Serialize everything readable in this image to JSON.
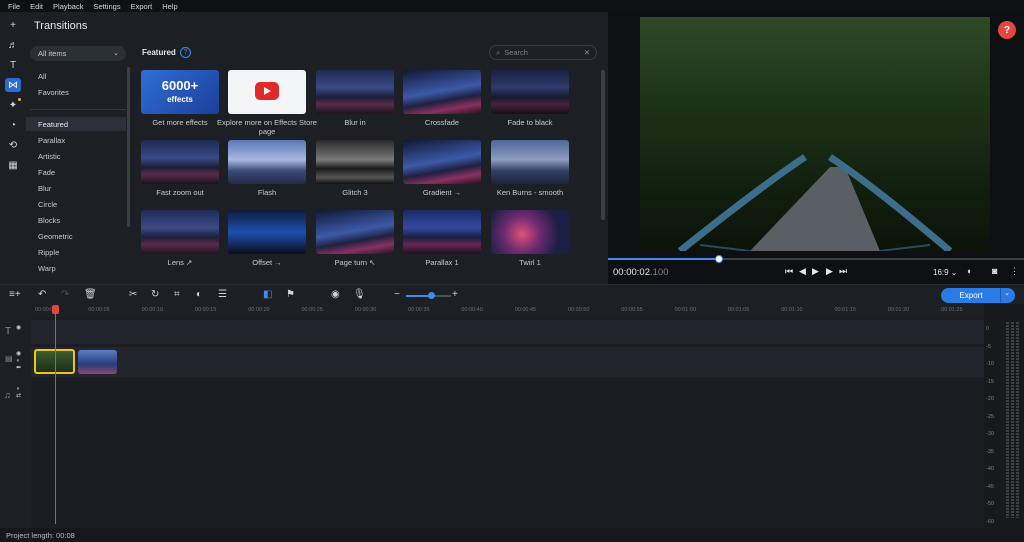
{
  "menu": [
    "File",
    "Edit",
    "Playback",
    "Settings",
    "Export",
    "Help"
  ],
  "panel": {
    "title": "Transitions",
    "filter": "All items",
    "search_placeholder": "Search",
    "featured": "Featured"
  },
  "categories": [
    "All",
    "Favorites",
    "Featured",
    "Parallax",
    "Artistic",
    "Fade",
    "Blur",
    "Circle",
    "Blocks",
    "Geometric",
    "Ripple",
    "Warp"
  ],
  "selected_category": "Featured",
  "tiles": [
    {
      "label": "Get more effects",
      "badge_big": "6000+",
      "badge_small": "effects"
    },
    {
      "label": "Explore more on Effects Store page"
    },
    {
      "label": "Blur in"
    },
    {
      "label": "Crossfade"
    },
    {
      "label": "Fade to black"
    },
    {
      "label": "Fast zoom out"
    },
    {
      "label": "Flash"
    },
    {
      "label": "Glitch 3"
    },
    {
      "label": "Gradient →"
    },
    {
      "label": "Ken Burns - smooth"
    },
    {
      "label": "Lens ↗"
    },
    {
      "label": "Offset →"
    },
    {
      "label": "Page turn ↖"
    },
    {
      "label": "Parallax 1"
    },
    {
      "label": "Twirl 1"
    }
  ],
  "player": {
    "timecode": "00:00:02",
    "frames": ".100",
    "aspect": "16:9",
    "progress": 0.26
  },
  "timeline": {
    "export_label": "Export",
    "ticks": [
      "00:00:00",
      "00:00:05",
      "00:00:10",
      "00:00:15",
      "00:00:20",
      "00:00:25",
      "00:00:30",
      "00:00:35",
      "00:00:40",
      "00:00:45",
      "00:00:50",
      "00:00:55",
      "00:01:00",
      "00:01:05",
      "00:01:10",
      "00:01:15",
      "00:01:20",
      "00:01:25"
    ]
  },
  "meter_labels": [
    "0",
    "-5",
    "-10",
    "-15",
    "-20",
    "-25",
    "-30",
    "-35",
    "-40",
    "-45",
    "-50",
    "-60"
  ],
  "status": "Project length: 00:08",
  "colors": {
    "accent": "#2a7be4",
    "playhead": "#e2483e",
    "clip_selected": "#f0c419"
  }
}
